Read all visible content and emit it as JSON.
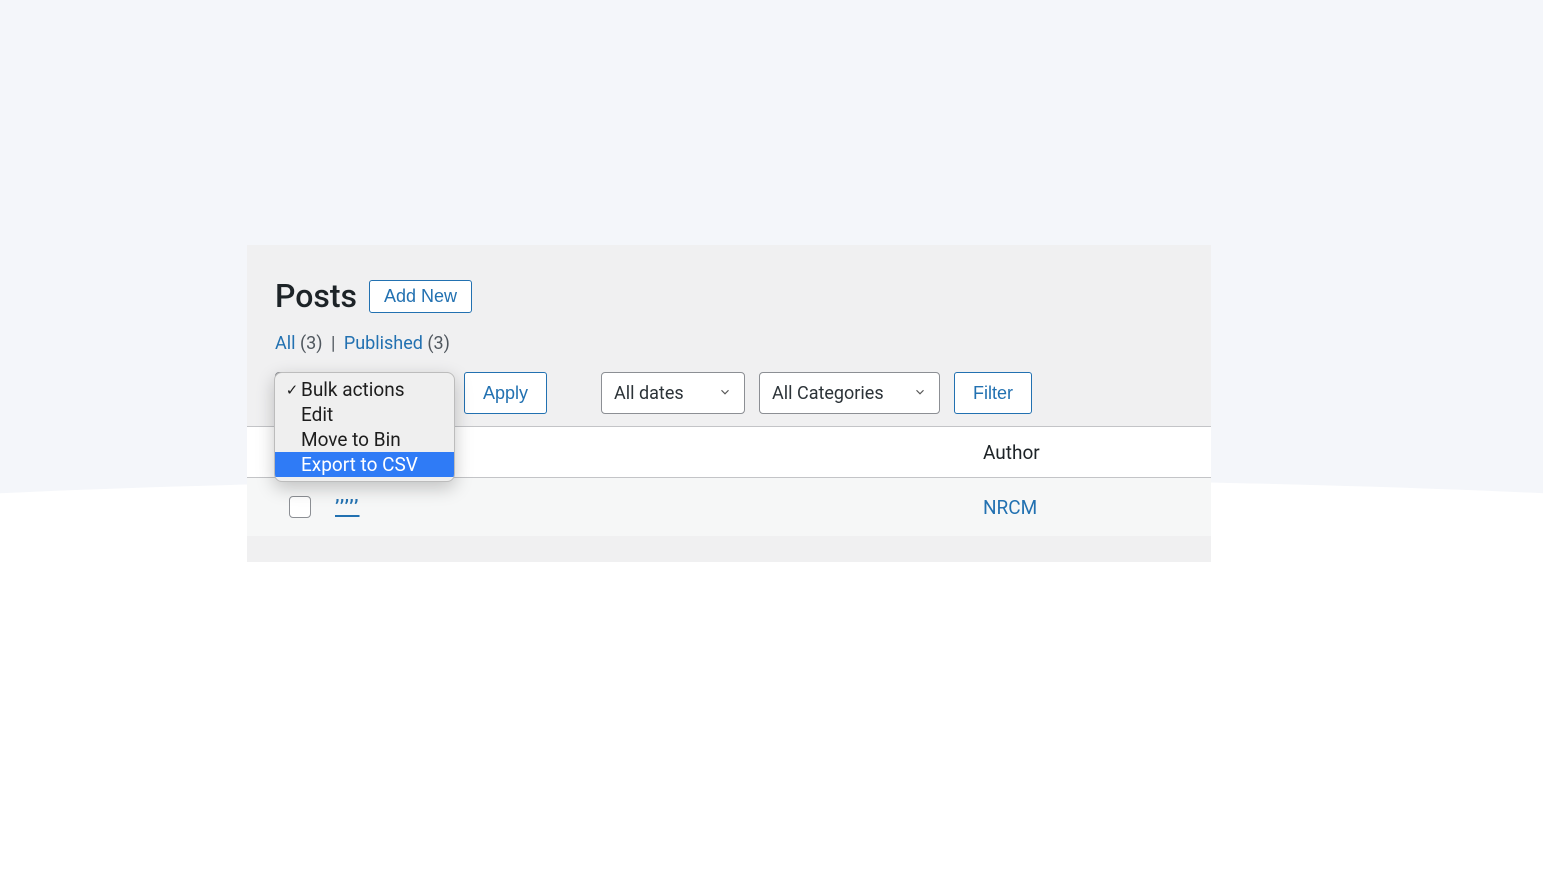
{
  "header": {
    "title": "Posts",
    "add_new_label": "Add New"
  },
  "status_filters": {
    "all_label": "All",
    "all_count": "(3)",
    "published_label": "Published",
    "published_count": "(3)"
  },
  "bulk_actions": {
    "items": [
      {
        "label": "Bulk actions",
        "checked": true,
        "highlighted": false
      },
      {
        "label": "Edit",
        "checked": false,
        "highlighted": false
      },
      {
        "label": "Move to Bin",
        "checked": false,
        "highlighted": false
      },
      {
        "label": "Export to CSV",
        "checked": false,
        "highlighted": true
      }
    ]
  },
  "toolbar": {
    "apply_label": "Apply",
    "dates_label": "All dates",
    "categories_label": "All Categories",
    "filter_label": "Filter"
  },
  "table": {
    "columns": {
      "author": "Author"
    },
    "rows": [
      {
        "title": "’’’’’",
        "author": "NRCM"
      }
    ]
  }
}
